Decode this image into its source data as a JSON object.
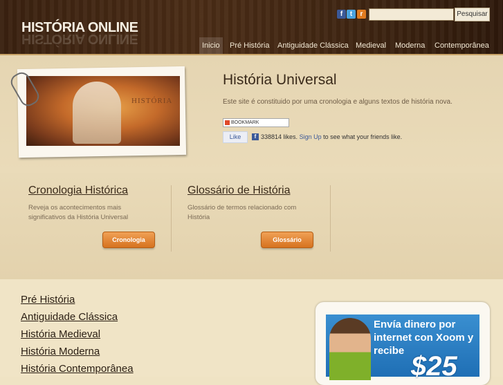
{
  "site": {
    "logo": "HISTÓRIA ONLINE"
  },
  "header": {
    "social": {
      "facebook_glyph": "f",
      "twitter_glyph": "t",
      "rss_glyph": "r"
    },
    "search": {
      "button_label": "Pesquisar",
      "value": ""
    }
  },
  "nav": {
    "items": [
      {
        "label": "Inicio",
        "active": true
      },
      {
        "label": "Pré História"
      },
      {
        "label": "Antiguidade Clássica"
      },
      {
        "label": "Medieval"
      },
      {
        "label": "Moderna"
      },
      {
        "label": "Contemporânea"
      }
    ]
  },
  "feature": {
    "image_caption": "HISTÓRIA",
    "title": "História Universal",
    "description": "Este site é constituido por uma cronologia e alguns textos de história nova.",
    "bookmark_label": "BOOKMARK",
    "like_label": "Like",
    "like_count_text": "338814 likes.",
    "signup_label": "Sign Up",
    "signup_suffix": "to see what your friends like."
  },
  "cards": [
    {
      "title": "Cronologia Histórica",
      "text": "Reveja os acontecimentos mais significativos da História Universal",
      "button": "Cronologia"
    },
    {
      "title": "Glossário de História",
      "text": "Glossário de termos relacionado com História",
      "button": "Glossário"
    }
  ],
  "links": [
    "Pré História",
    "Antiguidade Clássica",
    "História Medieval",
    "História Moderna",
    "História Contemporânea"
  ],
  "ad": {
    "headline": "Envía dinero por internet con Xoom y recibe",
    "amount": "$25"
  },
  "icons": [
    "facebook-icon",
    "twitter-icon",
    "rss-icon",
    "paperclip-icon",
    "bookmark-icon",
    "facebook-like-icon"
  ]
}
